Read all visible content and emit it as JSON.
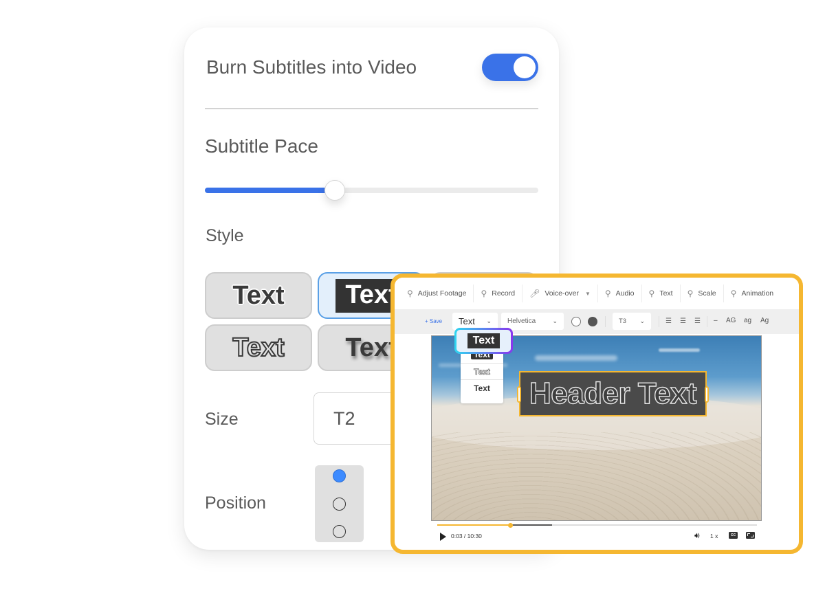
{
  "settings": {
    "burn_subtitles_label": "Burn Subtitles into Video",
    "burn_subtitles_enabled": true,
    "subtitle_pace_label": "Subtitle Pace",
    "subtitle_pace_value": 0.39,
    "style_label": "Style",
    "style_options": [
      {
        "label": "Text",
        "variant": "white-outline",
        "selected": false
      },
      {
        "label": "Text",
        "variant": "dark-box",
        "selected": true
      },
      {
        "label": "",
        "variant": "hidden-behind-panel",
        "selected": false
      },
      {
        "label": "Text",
        "variant": "hollow-outline",
        "selected": false
      },
      {
        "label": "Text",
        "variant": "drop-shadow",
        "selected": false
      }
    ],
    "size_label": "Size",
    "size_value": "T2",
    "position_label": "Position",
    "position_options": [
      "top",
      "middle",
      "bottom"
    ],
    "position_selected": "top"
  },
  "editor": {
    "menu": [
      {
        "label": "Adjust Footage",
        "icon": "search-icon"
      },
      {
        "label": "Record",
        "icon": "search-icon"
      },
      {
        "label": "Voice-over",
        "icon": "microphone-icon",
        "has_dropdown": true
      },
      {
        "label": "Audio",
        "icon": "search-icon"
      },
      {
        "label": "Text",
        "icon": "search-icon"
      },
      {
        "label": "Scale",
        "icon": "search-icon"
      },
      {
        "label": "Animation",
        "icon": "search-icon"
      }
    ],
    "toolbar": {
      "save_label": "+ Save",
      "text_type": "Text",
      "font": "Helvetica",
      "colors": [
        "#ffffff",
        "#555555"
      ],
      "size": "T3",
      "case_options": [
        "AG",
        "ag",
        "Ag"
      ],
      "dash_label": "–"
    },
    "style_picker": {
      "current": "Text",
      "options": [
        "Text",
        "Text",
        "Text"
      ]
    },
    "overlay_text": "Header Text",
    "player": {
      "current_time": "0:03",
      "duration": "10:30",
      "time_display": "0:03 / 10:30",
      "played_fraction": 0.23,
      "buffered_fraction": 0.36,
      "speed": "1 x",
      "cc_label": "CC"
    }
  },
  "colors": {
    "accent_blue": "#3a72e8",
    "highlight_yellow": "#f5b731",
    "radio_blue": "#3d8bff"
  }
}
